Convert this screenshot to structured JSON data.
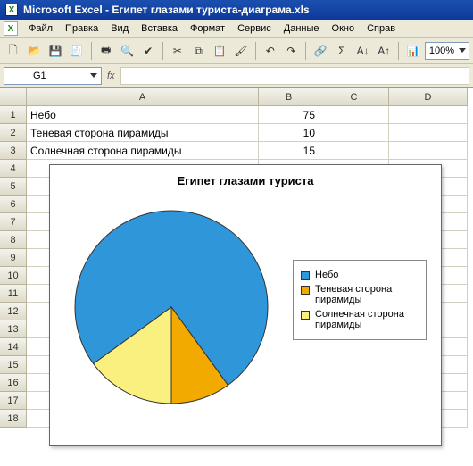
{
  "titlebar": {
    "app": "Microsoft Excel",
    "separator": " - ",
    "doc": "Египет глазами туриста-диаграма.xls"
  },
  "menu": {
    "items": [
      "Файл",
      "Правка",
      "Вид",
      "Вставка",
      "Формат",
      "Сервис",
      "Данные",
      "Окно",
      "Справ"
    ]
  },
  "toolbar": {
    "zoom": "100%"
  },
  "formula_bar": {
    "name_box": "G1",
    "fx": "fx"
  },
  "columns": [
    "A",
    "B",
    "C",
    "D"
  ],
  "rows_visible": 18,
  "cells": {
    "A1": "Небо",
    "B1": "75",
    "A2": "Теневая сторона пирамиды",
    "B2": "10",
    "A3": "Солнечная сторона пирамиды",
    "B3": "15"
  },
  "chart_data": {
    "type": "pie",
    "title": "Египет глазами туриста",
    "categories": [
      "Небо",
      "Теневая сторона пирамиды",
      "Солнечная сторона пирамиды"
    ],
    "values": [
      75,
      10,
      15
    ],
    "colors": [
      "#2f96d9",
      "#f2a900",
      "#f9f080"
    ],
    "legend_position": "right"
  }
}
